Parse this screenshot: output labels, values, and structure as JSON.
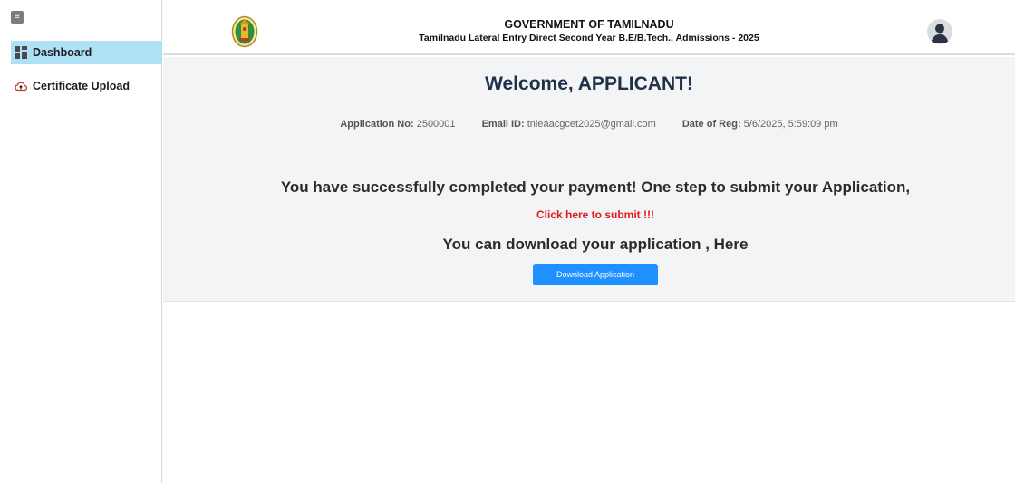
{
  "sidebar": {
    "toggle_glyph": "≡",
    "items": [
      {
        "label": "Dashboard",
        "icon": "dashboard-icon",
        "active": true
      },
      {
        "label": "Certificate Upload",
        "icon": "cloud-upload-icon",
        "active": false
      }
    ]
  },
  "header": {
    "title": "GOVERNMENT OF TAMILNADU",
    "subtitle": "Tamilnadu Lateral Entry Direct Second Year B.E/B.Tech., Admissions - 2025",
    "emblem_icon": "tamilnadu-emblem-icon",
    "avatar_icon": "user-avatar-icon"
  },
  "main": {
    "welcome": "Welcome, APPLICANT!",
    "application_no_label": "Application No:",
    "application_no": "2500001",
    "email_label": "Email ID:",
    "email": "tnleaacgcet2025@gmail.com",
    "date_label": "Date of Reg:",
    "date": "5/6/2025, 5:59:09 pm",
    "success_message": "You have successfully completed your payment! One step to submit your Application,",
    "submit_link": "Click here to submit !!!",
    "download_message": "You can download your application , Here",
    "download_button": "Download Application"
  },
  "colors": {
    "active_nav": "#aee0f6",
    "button": "#1e90ff",
    "submit_link": "#e01a1a",
    "welcome_text": "#1f3148",
    "main_background": "#f3f4f6"
  }
}
